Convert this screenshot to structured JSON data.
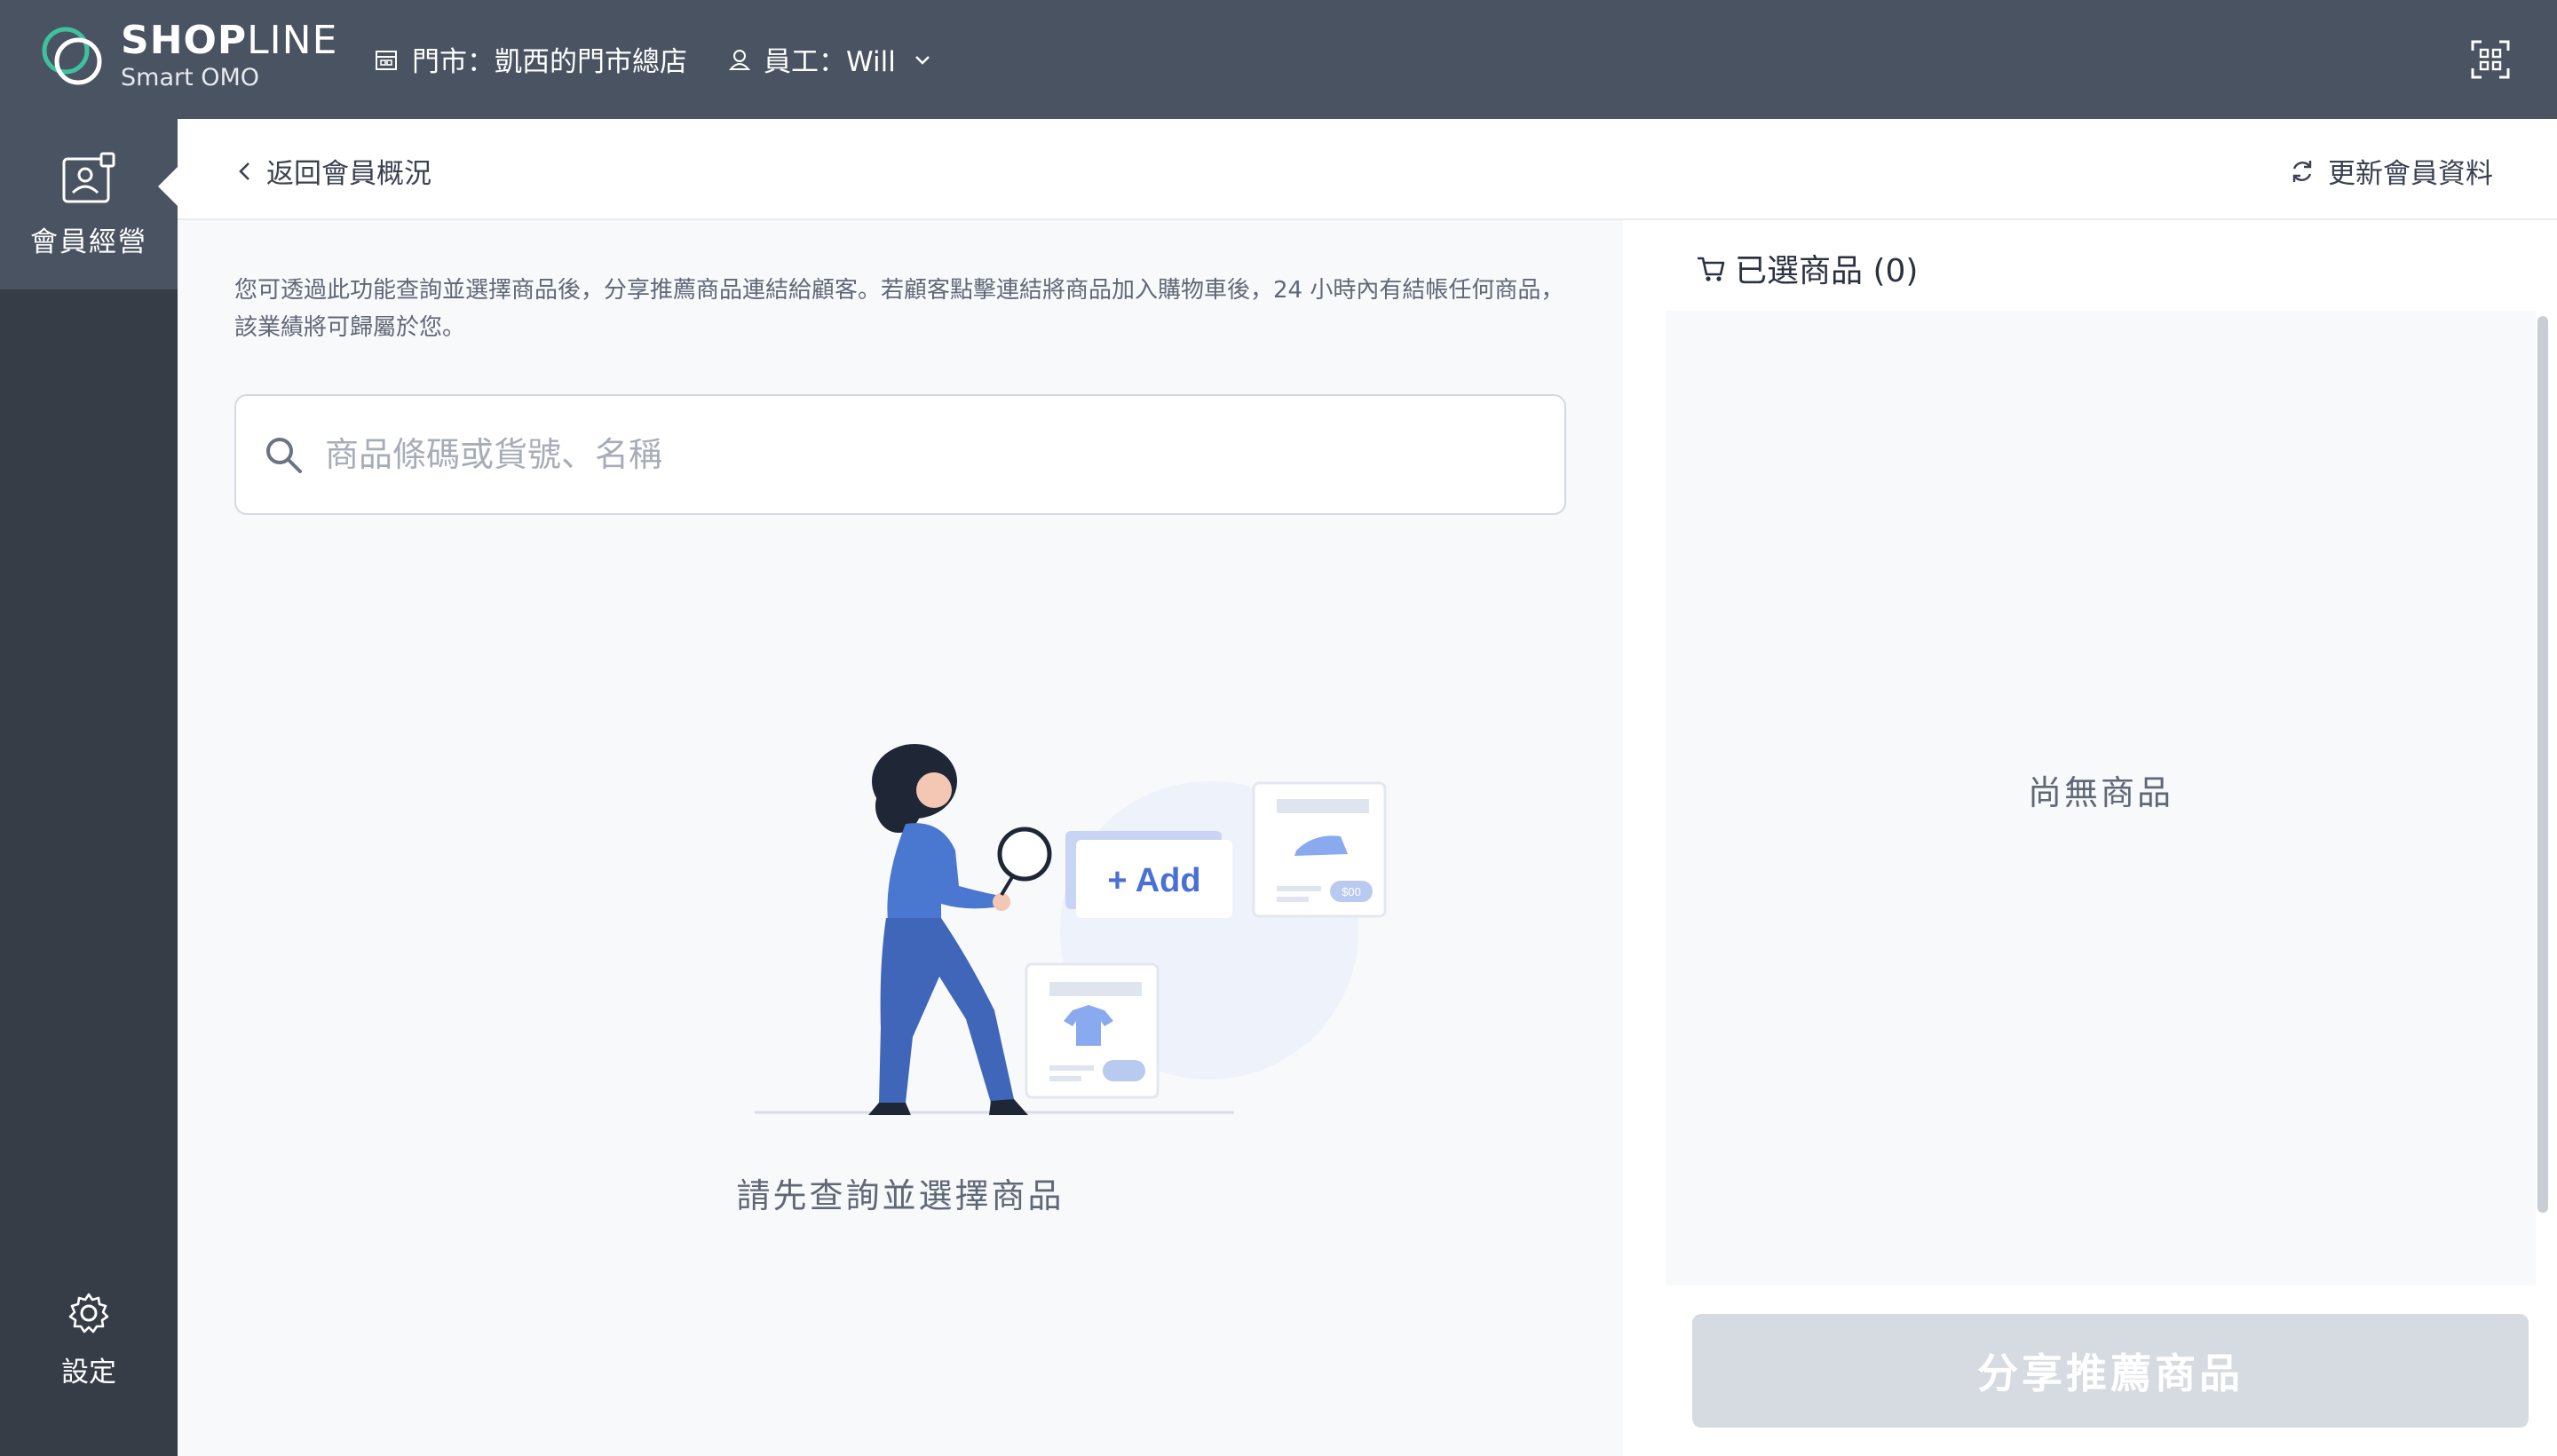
{
  "header": {
    "brand_bold": "SHOP",
    "brand_thin": "LINE",
    "brand_sub": "Smart OMO",
    "store_label": "門市：凱西的門市總店",
    "staff_label": "員工：Will",
    "icons": {
      "store": "store-icon",
      "staff": "user-icon",
      "dropdown": "chevron-down-icon",
      "scan": "qr-scan-icon"
    }
  },
  "sidebar": {
    "active_item": {
      "label": "會員經營",
      "icon": "member-card-icon"
    },
    "settings": {
      "label": "設定",
      "icon": "gear-icon"
    }
  },
  "subheader": {
    "back_label": "返回會員概況",
    "refresh_label": "更新會員資料"
  },
  "main": {
    "description": "您可透過此功能查詢並選擇商品後，分享推薦商品連結給顧客。若顧客點擊連結將商品加入購物車後，24 小時內有結帳任何商品，該業績將可歸屬於您。",
    "search": {
      "placeholder": "商品條碼或貨號、名稱",
      "value": ""
    },
    "illustration": {
      "add_label": "+ Add",
      "price_tag": "$00"
    },
    "empty_hint": "請先查詢並選擇商品"
  },
  "cart": {
    "title": "已選商品 (0)",
    "empty_text": "尚無商品",
    "share_button": "分享推薦商品"
  },
  "colors": {
    "topbar": "#4a5361",
    "sidebar": "#363d47",
    "accent_blue": "#4a6fd6",
    "button_disabled": "#d6dbe2"
  }
}
